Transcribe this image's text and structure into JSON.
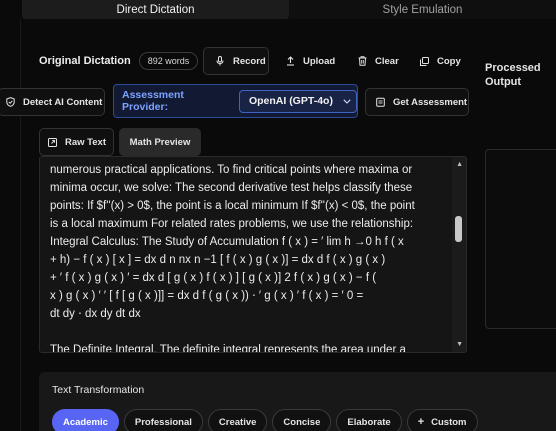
{
  "tabs": [
    {
      "label": "Direct Dictation",
      "active": true
    },
    {
      "label": "Style Emulation",
      "active": false
    }
  ],
  "original": {
    "title": "Original Dictation",
    "word_count": "892 words"
  },
  "toolbar": {
    "record": "Record",
    "upload": "Upload",
    "clear": "Clear",
    "copy": "Copy"
  },
  "processed_output": {
    "title": "Processed Output"
  },
  "detect_ai": {
    "label": "Detect AI Content"
  },
  "assessment": {
    "label": "Assessment Provider:",
    "selected": "OpenAI (GPT-4o)",
    "button": "Get Assessment"
  },
  "view_tabs": {
    "raw": "Raw Text",
    "math": "Math Preview"
  },
  "editor": {
    "lines": [
      "numerous practical applications. To find critical points where maxima or",
      "minima occur, we solve: The second derivative test helps classify these",
      "points: If $f''(x) > 0$, the point is a local minimum If $f''(x) < 0$, the point",
      "is a local maximum For related rates problems, we use the relationship:",
      "Integral Calculus: The Study of Accumulation  f  ( x ) = ′  lim h →0   h f ( x",
      "+ h) − f ( x )  [ x  ] = dx d   n   nx n −1  [ f ( x ) g ( x )] = dx d   f  ( x ) g ( x )",
      "+ ′  f ( x ) g  ( x ) ′ = dx d   [  g ( x ) f ( x )  ]  [ g ( x )] 2  f  ( x ) g ( x ) − f (",
      "x ) g  ( x ) ′  ′ [ f [ g ( x )]] = dx d   f  ( g ( x )) ⋅ ′  g  ( x ) ′  f  ( x ) = ′  0  =",
      "dt dy   ⋅ dx dy  dt dx",
      "",
      "The Definite Integral. The definite integral represents the area under a"
    ]
  },
  "transformation": {
    "title": "Text Transformation",
    "options": [
      {
        "label": "Academic",
        "active": true
      },
      {
        "label": "Professional",
        "active": false
      },
      {
        "label": "Creative",
        "active": false
      },
      {
        "label": "Concise",
        "active": false
      },
      {
        "label": "Elaborate",
        "active": false
      }
    ],
    "custom": "Custom"
  },
  "icons": {
    "record": "microphone-icon",
    "upload": "upload-icon",
    "clear": "trash-icon",
    "copy": "copy-icon",
    "detect": "shield-icon",
    "assessment": "clipboard-icon",
    "raw": "external-link-icon",
    "dropdown": "chevron-down-icon",
    "custom": "plus-icon"
  },
  "colors": {
    "accent": "#5865f2",
    "provider_border": "#2f4a96",
    "provider_label": "#7ea2ff"
  }
}
